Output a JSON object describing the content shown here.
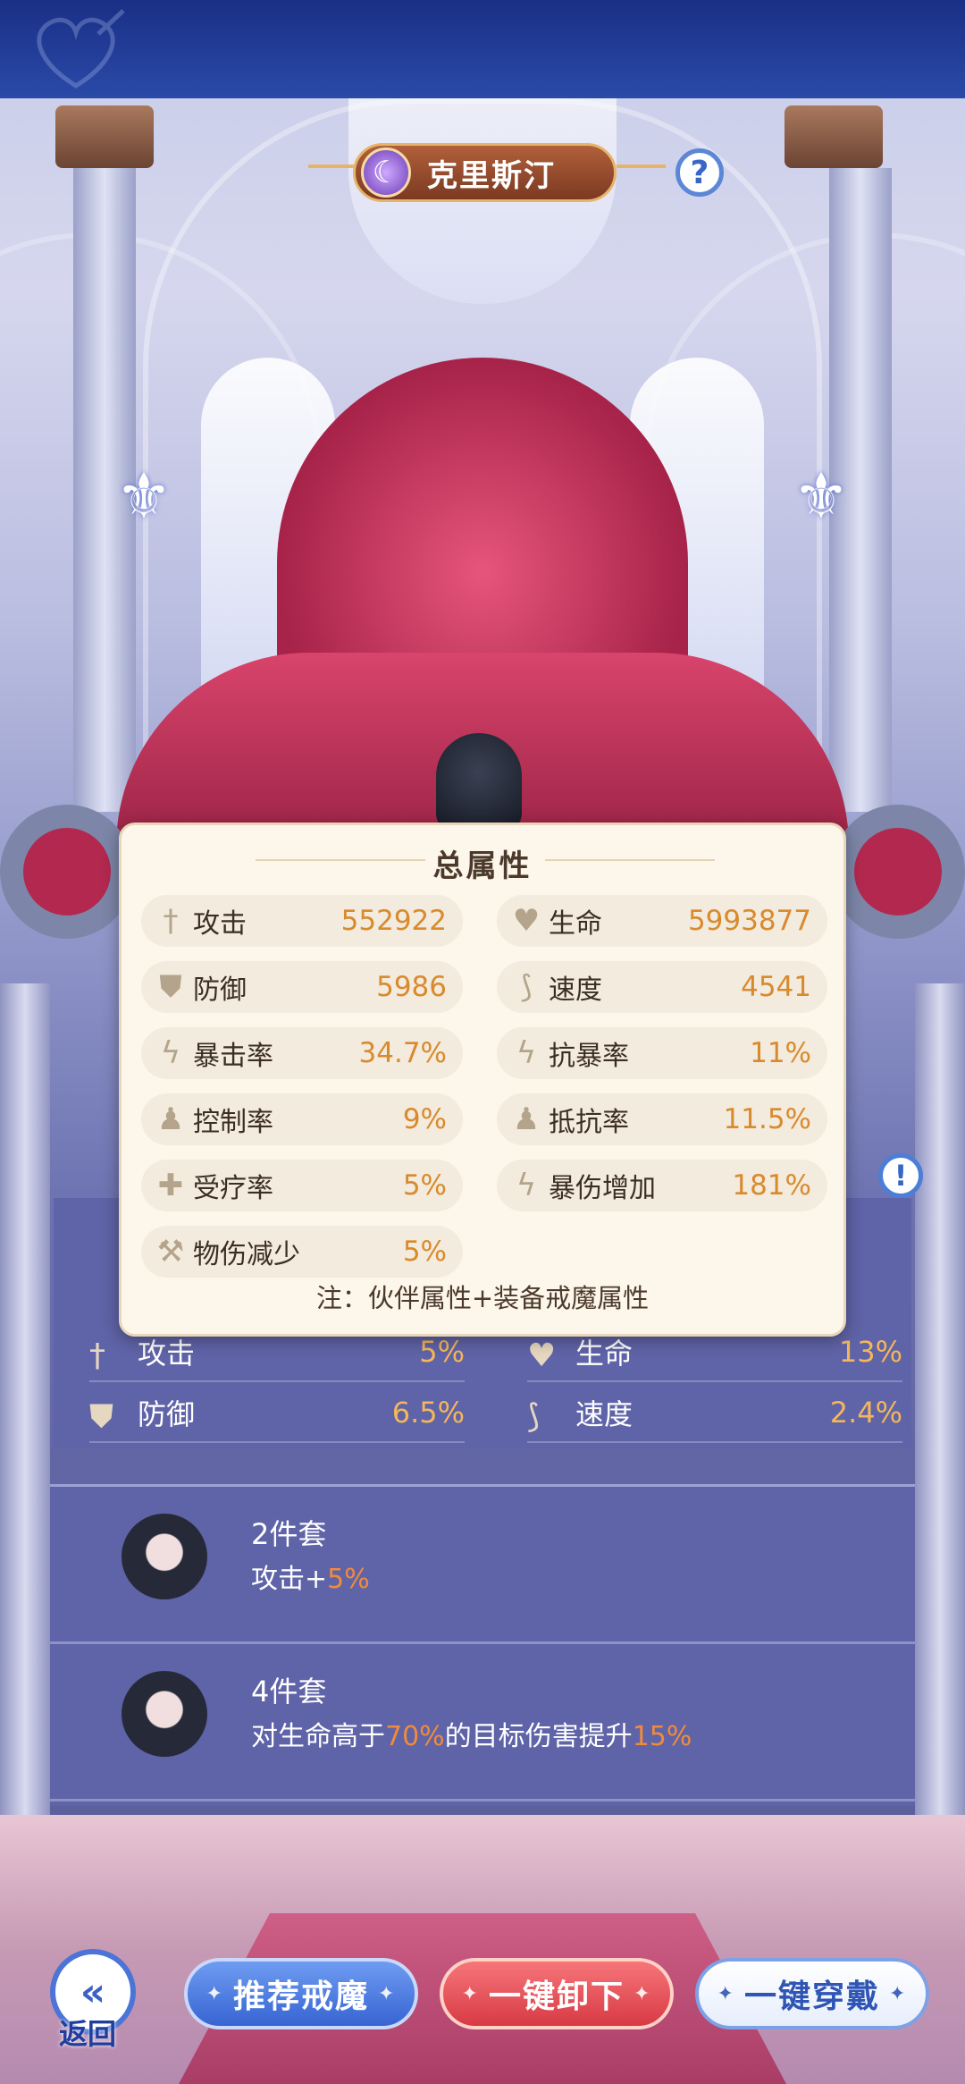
{
  "header": {
    "character_name": "克里斯汀",
    "moon_glyph": "☾",
    "help_glyph": "?"
  },
  "total_attributes": {
    "title": "总属性",
    "stats": [
      {
        "icon": "sword-icon",
        "glyph": "†",
        "label": "攻击",
        "value": "552922"
      },
      {
        "icon": "heart-icon",
        "glyph": "♥",
        "label": "生命",
        "value": "5993877"
      },
      {
        "icon": "shield-icon",
        "glyph": "⛊",
        "label": "防御",
        "value": "5986"
      },
      {
        "icon": "boot-icon",
        "glyph": "⟆",
        "label": "速度",
        "value": "4541"
      },
      {
        "icon": "crit-icon",
        "glyph": "ϟ",
        "label": "暴击率",
        "value": "34.7%"
      },
      {
        "icon": "crit-resist-icon",
        "glyph": "ϟ",
        "label": "抗暴率",
        "value": "11%"
      },
      {
        "icon": "control-icon",
        "glyph": "♟",
        "label": "控制率",
        "value": "9%"
      },
      {
        "icon": "resist-icon",
        "glyph": "♟",
        "label": "抵抗率",
        "value": "11.5%"
      },
      {
        "icon": "heal-icon",
        "glyph": "✚",
        "label": "受疗率",
        "value": "5%"
      },
      {
        "icon": "crit-damage-icon",
        "glyph": "ϟ",
        "label": "暴伤增加",
        "value": "181%"
      },
      {
        "icon": "physical-reduction-icon",
        "glyph": "⚒",
        "label": "物伤减少",
        "value": "5%"
      }
    ],
    "note": "注：伙伴属性+装备戒魔属性"
  },
  "underlay_stats": [
    {
      "label": "攻击",
      "value": "5%"
    },
    {
      "label": "生命",
      "value": "13%"
    },
    {
      "label": "防御",
      "value": "6.5%"
    },
    {
      "label": "速度",
      "value": "2.4%"
    }
  ],
  "sets": [
    {
      "title": "2件套",
      "desc_prefix": "攻击+",
      "desc_hl1": "5%",
      "desc_mid": "",
      "desc_hl2": "",
      "desc_suffix": ""
    },
    {
      "title": "4件套",
      "desc_prefix": "对生命高于",
      "desc_hl1": "70%",
      "desc_mid": "的目标伤害提升",
      "desc_hl2": "15%",
      "desc_suffix": ""
    }
  ],
  "footer": {
    "back_label": "返回",
    "back_glyph": "«",
    "recommend_label": "推荐戒魔",
    "unequip_label": "一键卸下",
    "equip_label": "一键穿戴",
    "spark": "✦"
  },
  "info_glyph": "!",
  "fleur_glyph": "⚜",
  "colors": {
    "accent_orange": "#d98a2d",
    "highlight": "#f08b3c",
    "panel_bg": "#fdf6ea",
    "btn_blue": "#3764d2",
    "btn_red": "#d83a44"
  }
}
